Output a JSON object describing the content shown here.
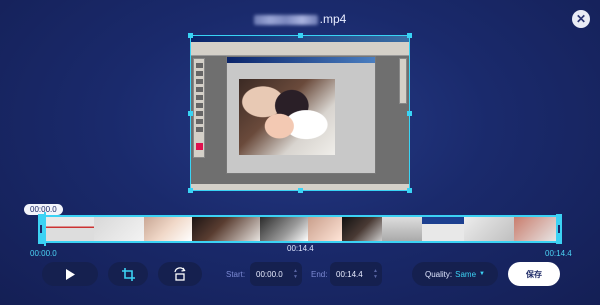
{
  "header": {
    "file_name_suffix": ".mp4",
    "close_label": "✕"
  },
  "timeline": {
    "current_time": "00:00.0",
    "start_label": "00:00.0",
    "end_label": "00:14.4",
    "mid_label": "00:14.4"
  },
  "controls": {
    "play_icon": "play-icon",
    "crop_icon": "crop-icon",
    "rotate_icon": "rotate-icon",
    "start_label": "Start:",
    "start_value": "00:00.0",
    "end_label": "End:",
    "end_value": "00:14.4",
    "quality_label": "Quality:",
    "quality_value": "Same",
    "save_label": "保存"
  },
  "colors": {
    "accent": "#3cd2f4",
    "background": "#1a2a6c"
  }
}
